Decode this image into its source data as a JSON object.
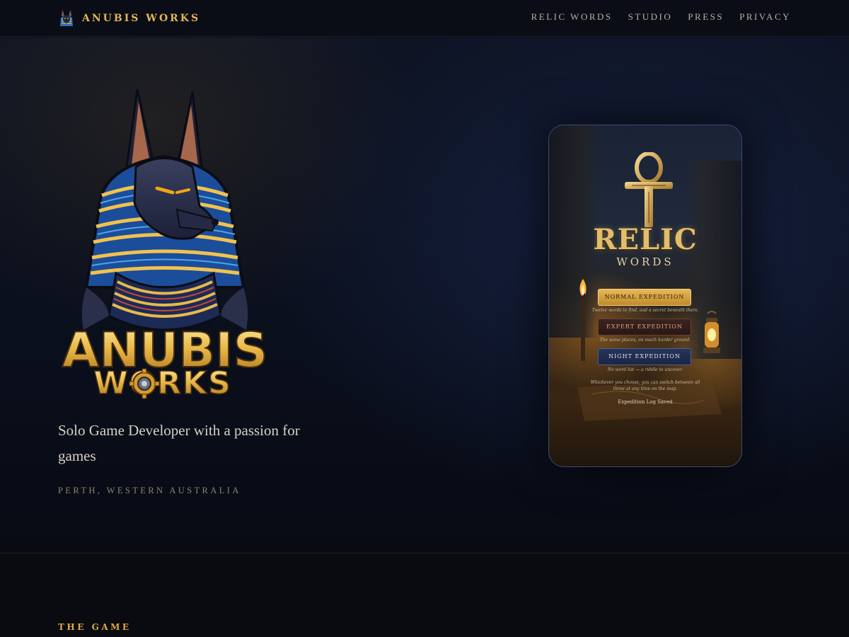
{
  "brand": {
    "name": "ANUBIS WORKS",
    "icon": "anubis-head-icon"
  },
  "nav": {
    "items": [
      {
        "label": "RELIC WORDS"
      },
      {
        "label": "STUDIO"
      },
      {
        "label": "PRESS"
      },
      {
        "label": "PRIVACY"
      }
    ]
  },
  "hero": {
    "logo": {
      "line1": "ANUBIS",
      "line2": "WORKS"
    },
    "tagline": "Solo Game Developer with a passion for games",
    "location": "PERTH, WESTERN AUSTRALIA"
  },
  "game_preview": {
    "title": "RELIC",
    "subtitle": "WORDS",
    "modes": [
      {
        "label": "NORMAL EXPEDITION",
        "description": "Twelve words to find, and a secret beneath them."
      },
      {
        "label": "EXPERT EXPEDITION",
        "description": "The same places, on much harder ground."
      },
      {
        "label": "NIGHT EXPEDITION",
        "description": "No word list — a riddle to uncover."
      }
    ],
    "switch_note": "Whichever you choose, you can switch between all three at any time on the map.",
    "log_status": "Expedition Log Saved"
  },
  "sections": {
    "game_label": "THE GAME"
  },
  "colors": {
    "accent_gold": "#e3b556",
    "background": "#0a0b10",
    "section_gold": "#e0a64a"
  }
}
